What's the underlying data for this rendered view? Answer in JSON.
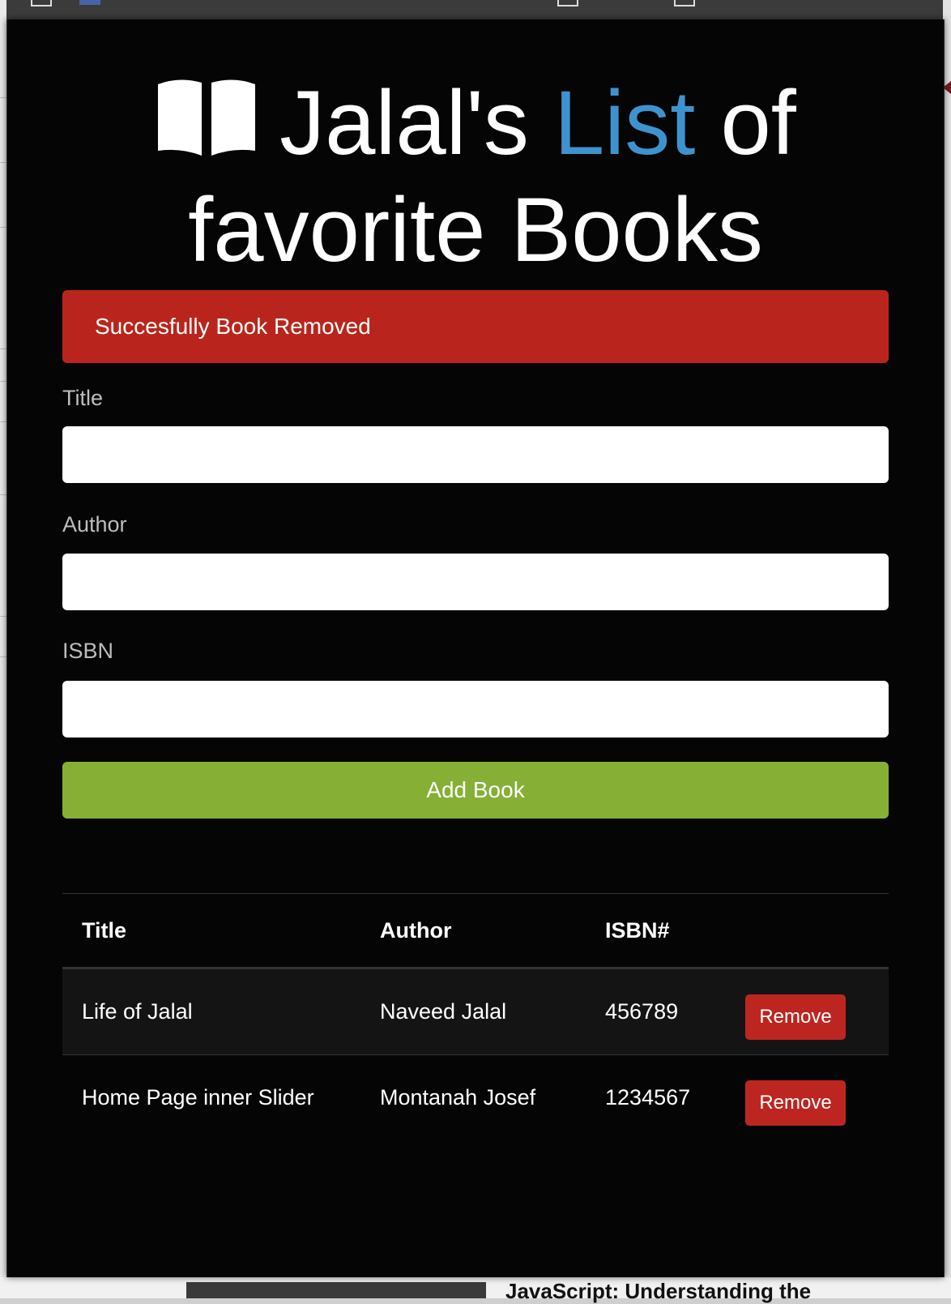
{
  "heading": {
    "before": "Jalal's",
    "accent": "List",
    "after": "of",
    "line2": "favorite Books",
    "accent_color": "#3e93cf",
    "icon": "open-book-icon"
  },
  "alert": {
    "message": "Succesfully Book Removed",
    "color": "#b9251c"
  },
  "form": {
    "title_label": "Title",
    "title_value": "",
    "author_label": "Author",
    "author_value": "",
    "isbn_label": "ISBN",
    "isbn_value": "",
    "submit_label": "Add Book",
    "submit_color": "#86b035"
  },
  "table": {
    "headers": [
      "Title",
      "Author",
      "ISBN#"
    ],
    "rows": [
      {
        "title": "Life of Jalal",
        "author": "Naveed Jalal",
        "isbn": "456789",
        "action": "Remove"
      },
      {
        "title": "Home Page inner Slider",
        "author": "Montanah Josef",
        "isbn": "1234567",
        "action": "Remove"
      }
    ]
  },
  "background": {
    "article_text": "JavaScript: Understanding the"
  }
}
